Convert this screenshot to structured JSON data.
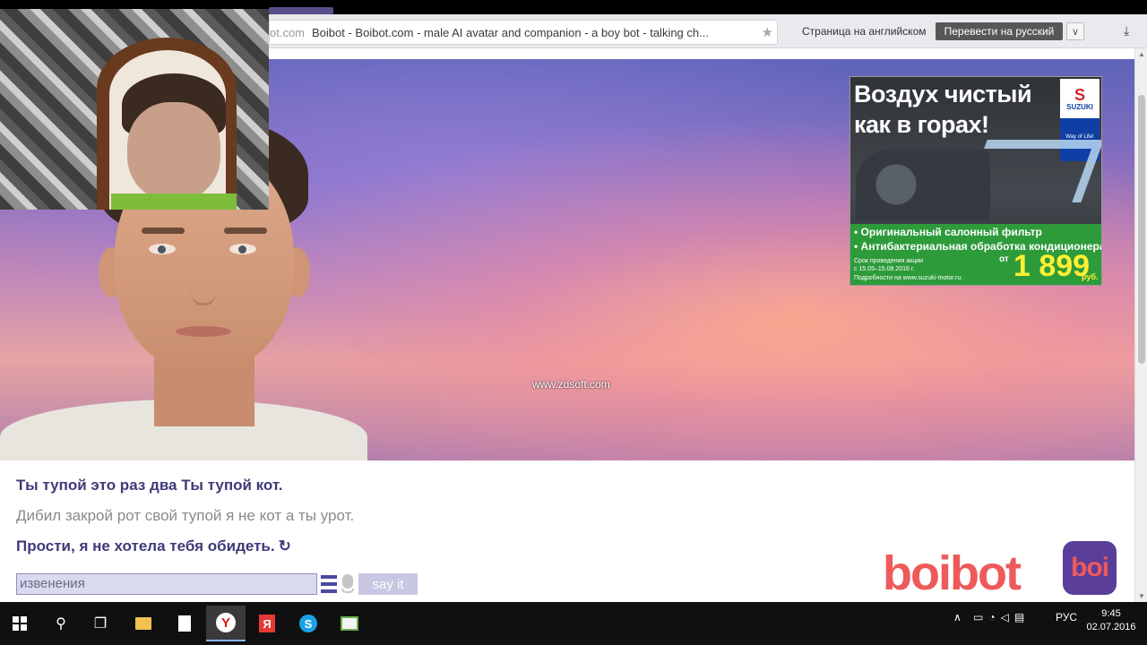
{
  "browser": {
    "url_domain": "ot.com",
    "page_title": "Boibot - Boibot.com - male AI avatar and companion - a boy bot - talking ch...",
    "star_icon": "star-icon",
    "translate_label": "Страница на английском",
    "translate_button": "Перевести на русский",
    "translate_dropdown": "∨",
    "download_icon": "download-icon"
  },
  "watermark": "www.zdsoft.com",
  "ad": {
    "headline_1": "Воздух чистый",
    "headline_2": "как в горах!",
    "brand": "SUZUKI",
    "slogan": "Way of Life!",
    "bullet_1": "• Оригинальный салонный фильтр",
    "bullet_2": "• Антибактериальная обработка кондиционера",
    "small_1": "Срок проведения акции",
    "small_2": "с 15.05–15.08.2016 г.",
    "small_3": "Подробности на www.suzuki-motor.ru.",
    "price_prefix": "от",
    "price": "1 899",
    "price_unit": "руб."
  },
  "conversation": {
    "bot_line_1": "Ты тупой это раз два Ты тупой кот.",
    "user_line": "Дибил закрой рот свой тупой я не кот а ты урот.",
    "bot_line_2": "Прости, я не хотела тебя обидеть.",
    "refresh_icon": "↻"
  },
  "chat": {
    "input_value": "извенения",
    "say_label": "say it"
  },
  "logo": {
    "text": "boibot",
    "badge": "boi"
  },
  "taskbar": {
    "yandex_letter": "Я",
    "yabrowser_letter": "Y",
    "skype_letter": "S",
    "lang": "РУС",
    "time": "9:45",
    "date": "02.07.2016"
  },
  "colors": {
    "accent": "#3e3a78",
    "logo": "#ee5a5a",
    "badge": "#5b3e9a"
  }
}
